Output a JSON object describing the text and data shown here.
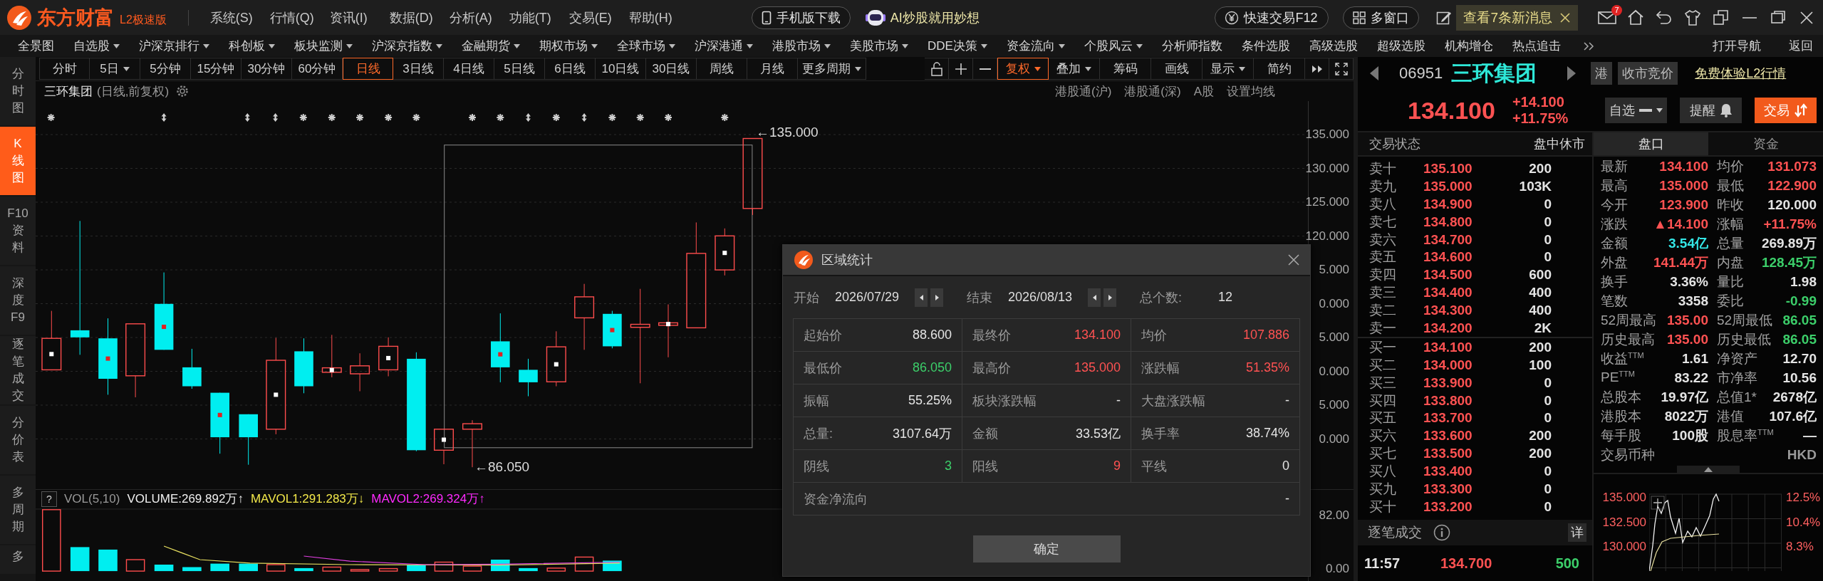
{
  "app": {
    "brand": "东方财富",
    "edition": "L2极速版",
    "menus": [
      "系统(S)",
      "行情(Q)",
      "资讯(I)",
      "数据(D)",
      "分析(A)",
      "功能(T)",
      "交易(E)",
      "帮助(H)"
    ],
    "mobile_button": "手机版下载",
    "ai_link": "AI炒股就用妙想",
    "quick_trade": "快速交易F12",
    "multi_window": "多窗口",
    "news": "查看7条新消息",
    "mail_badge": "7"
  },
  "nav": [
    {
      "label": "全景图",
      "dropdown": false
    },
    {
      "label": "自选股",
      "dropdown": true
    },
    {
      "label": "沪深京排行",
      "dropdown": true
    },
    {
      "label": "科创板",
      "dropdown": true
    },
    {
      "label": "板块监测",
      "dropdown": true
    },
    {
      "label": "沪深京指数",
      "dropdown": true
    },
    {
      "label": "金融期货",
      "dropdown": true
    },
    {
      "label": "期权市场",
      "dropdown": true
    },
    {
      "label": "全球市场",
      "dropdown": true
    },
    {
      "label": "沪深港通",
      "dropdown": true
    },
    {
      "label": "港股市场",
      "dropdown": true
    },
    {
      "label": "美股市场",
      "dropdown": true
    },
    {
      "label": "DDE决策",
      "dropdown": true
    },
    {
      "label": "资金流向",
      "dropdown": true
    },
    {
      "label": "个股风云",
      "dropdown": true
    },
    {
      "label": "分析师指数",
      "dropdown": false
    },
    {
      "label": "条件选股",
      "dropdown": false
    },
    {
      "label": "高级选股",
      "dropdown": false
    },
    {
      "label": "超级选股",
      "dropdown": false
    },
    {
      "label": "机构增仓",
      "dropdown": false
    },
    {
      "label": "热点追击",
      "dropdown": false
    }
  ],
  "nav_right": [
    "打开导航",
    "返回"
  ],
  "side_tabs": [
    {
      "label": "分时图",
      "selected": false
    },
    {
      "label": "K线图",
      "selected": true
    },
    {
      "label": "F10资料",
      "selected": false
    },
    {
      "label": "深度F9",
      "selected": false
    },
    {
      "label": "逐笔成交",
      "selected": false
    },
    {
      "label": "分价表",
      "selected": false
    },
    {
      "label": "多周期",
      "selected": false
    },
    {
      "label": "多",
      "selected": false
    }
  ],
  "periods": [
    {
      "label": "分时",
      "dropdown": false,
      "selected": false
    },
    {
      "label": "5日",
      "dropdown": true,
      "selected": false
    },
    {
      "label": "5分钟",
      "dropdown": false,
      "selected": false
    },
    {
      "label": "15分钟",
      "dropdown": false,
      "selected": false
    },
    {
      "label": "30分钟",
      "dropdown": false,
      "selected": false
    },
    {
      "label": "60分钟",
      "dropdown": false,
      "selected": false
    },
    {
      "label": "日线",
      "dropdown": false,
      "selected": true
    },
    {
      "label": "3日线",
      "dropdown": false,
      "selected": false
    },
    {
      "label": "4日线",
      "dropdown": false,
      "selected": false
    },
    {
      "label": "5日线",
      "dropdown": false,
      "selected": false
    },
    {
      "label": "6日线",
      "dropdown": false,
      "selected": false
    },
    {
      "label": "10日线",
      "dropdown": false,
      "selected": false
    },
    {
      "label": "30日线",
      "dropdown": false,
      "selected": false
    },
    {
      "label": "周线",
      "dropdown": false,
      "selected": false
    },
    {
      "label": "月线",
      "dropdown": false,
      "selected": false
    },
    {
      "label": "更多周期",
      "dropdown": true,
      "selected": false
    }
  ],
  "tools": [
    {
      "label": "复权",
      "dropdown": true,
      "selected": true
    },
    {
      "label": "叠加",
      "dropdown": true,
      "selected": false
    },
    {
      "label": "筹码",
      "dropdown": false,
      "selected": false
    },
    {
      "label": "画线",
      "dropdown": false,
      "selected": false
    },
    {
      "label": "显示",
      "dropdown": true,
      "selected": false
    },
    {
      "label": "简约",
      "dropdown": false,
      "selected": false
    }
  ],
  "chart": {
    "title": "三环集团",
    "subtitle": "(日线,前复权)",
    "links": [
      "港股通(沪)",
      "港股通(深)",
      "A股",
      "设置均线"
    ],
    "price_ticks": [
      "135.000",
      "130.000",
      "125.000",
      "120.000",
      "5.000",
      "0.000",
      "5.000",
      "0.000",
      "5.000",
      "0.000"
    ],
    "high_label": "←135.000",
    "low_label": "←86.050"
  },
  "volume": {
    "help": "?",
    "name": "VOL(5,10)",
    "volume": "VOLUME:269.892万↑",
    "mavol1": "MAVOL1:291.283万↓",
    "mavol2": "MAVOL2:269.324万↑",
    "ticks": [
      "82.00",
      "0.00"
    ]
  },
  "quote": {
    "code": "06951",
    "name": "三环集团",
    "market": "港",
    "session": "收市竞价",
    "l2_link": "免费体验L2行情",
    "price": "134.100",
    "change": "+14.100",
    "change_pct": "+11.75%",
    "watch": "自选",
    "alert": "提醒",
    "trade": "交易",
    "status_label": "交易状态",
    "status": "盘中休市",
    "asks": [
      {
        "label": "卖十",
        "price": "135.100",
        "qty": "200"
      },
      {
        "label": "卖九",
        "price": "135.000",
        "qty": "103K"
      },
      {
        "label": "卖八",
        "price": "134.900",
        "qty": "0"
      },
      {
        "label": "卖七",
        "price": "134.800",
        "qty": "0"
      },
      {
        "label": "卖六",
        "price": "134.700",
        "qty": "0"
      },
      {
        "label": "卖五",
        "price": "134.600",
        "qty": "0"
      },
      {
        "label": "卖四",
        "price": "134.500",
        "qty": "600"
      },
      {
        "label": "卖三",
        "price": "134.400",
        "qty": "400"
      },
      {
        "label": "卖二",
        "price": "134.300",
        "qty": "400"
      },
      {
        "label": "卖一",
        "price": "134.200",
        "qty": "2K"
      }
    ],
    "bids": [
      {
        "label": "买一",
        "price": "134.100",
        "qty": "200"
      },
      {
        "label": "买二",
        "price": "134.000",
        "qty": "100"
      },
      {
        "label": "买三",
        "price": "133.900",
        "qty": "0"
      },
      {
        "label": "买四",
        "price": "133.800",
        "qty": "0"
      },
      {
        "label": "买五",
        "price": "133.700",
        "qty": "0"
      },
      {
        "label": "买六",
        "price": "133.600",
        "qty": "200"
      },
      {
        "label": "买七",
        "price": "133.500",
        "qty": "200"
      },
      {
        "label": "买八",
        "price": "133.400",
        "qty": "0"
      },
      {
        "label": "买九",
        "price": "133.300",
        "qty": "0"
      },
      {
        "label": "买十",
        "price": "133.200",
        "qty": "0"
      }
    ],
    "tabs": [
      {
        "label": "盘口",
        "selected": true
      },
      {
        "label": "资金",
        "selected": false
      }
    ],
    "stats": [
      {
        "cells": [
          {
            "label": "最新",
            "value": "134.100",
            "color": "#ff5252"
          },
          {
            "label": "均价",
            "value": "131.073",
            "color": "#ff5252"
          }
        ]
      },
      {
        "cells": [
          {
            "label": "最高",
            "value": "135.000",
            "color": "#ff5252"
          },
          {
            "label": "最低",
            "value": "122.900",
            "color": "#ff5252"
          }
        ]
      },
      {
        "cells": [
          {
            "label": "今开",
            "value": "123.900",
            "color": "#ff5252"
          },
          {
            "label": "昨收",
            "value": "120.000",
            "color": "#e4e4e4"
          }
        ]
      },
      {
        "cells": [
          {
            "label": "涨跌",
            "value": "▲14.100",
            "color": "#ff5252"
          },
          {
            "label": "涨幅",
            "value": "+11.75%",
            "color": "#ff5252"
          }
        ]
      },
      {
        "cells": [
          {
            "label": "金额",
            "value": "3.54亿",
            "color": "#34e6e6"
          },
          {
            "label": "总量",
            "value": "269.89万",
            "color": "#e4e4e4"
          }
        ]
      },
      {
        "cells": [
          {
            "label": "外盘",
            "value": "141.44万",
            "color": "#ff5252"
          },
          {
            "label": "内盘",
            "value": "128.45万",
            "color": "#3ccf6a"
          }
        ]
      },
      {
        "cells": [
          {
            "label": "换手",
            "value": "3.36%",
            "color": "#e4e4e4"
          },
          {
            "label": "量比",
            "value": "1.98",
            "color": "#e4e4e4"
          }
        ]
      },
      {
        "cells": [
          {
            "label": "笔数",
            "value": "3358",
            "color": "#e4e4e4"
          },
          {
            "label": "委比",
            "value": "-0.99",
            "color": "#3ccf6a"
          }
        ]
      },
      {
        "cells": [
          {
            "label": "52周最高",
            "value": "135.00",
            "color": "#ff5252"
          },
          {
            "label": "52周最低",
            "value": "86.05",
            "color": "#3ccf6a"
          }
        ]
      },
      {
        "cells": [
          {
            "label": "历史最高",
            "value": "135.00",
            "color": "#ff5252"
          },
          {
            "label": "历史最低",
            "value": "86.05",
            "color": "#3ccf6a"
          }
        ]
      },
      {
        "cells": [
          {
            "label": "收益$^{TTM}$",
            "value": "1.61",
            "color": "#e4e4e4"
          },
          {
            "label": "净资产",
            "value": "12.70",
            "color": "#e4e4e4"
          }
        ]
      },
      {
        "cells": [
          {
            "label": "PE$^{TTM}$",
            "value": "83.22",
            "color": "#e4e4e4"
          },
          {
            "label": "市净率",
            "value": "10.56",
            "color": "#e4e4e4"
          }
        ]
      },
      {
        "cells": [
          {
            "label": "总股本",
            "value": "19.97亿",
            "color": "#e4e4e4"
          },
          {
            "label": "总值1*",
            "value": "2678亿",
            "color": "#e4e4e4"
          }
        ]
      },
      {
        "cells": [
          {
            "label": "港股本",
            "value": "8022万",
            "color": "#e4e4e4"
          },
          {
            "label": "港值",
            "value": "107.6亿",
            "color": "#e4e4e4"
          }
        ]
      },
      {
        "cells": [
          {
            "label": "每手股",
            "value": "100股",
            "color": "#e4e4e4"
          },
          {
            "label": "股息率$^{TTM}$",
            "value": "—",
            "color": "#e4e4e4"
          }
        ]
      },
      {
        "cells": [
          {
            "label": "交易币种",
            "value": "HKD",
            "color": "#9a9a9a"
          }
        ]
      }
    ],
    "trades_title": "逐笔成交",
    "detail": "详",
    "trades": [
      {
        "time": "11:57",
        "price": "134.700",
        "qty": "500",
        "color": "#3ccf6a"
      }
    ],
    "mini_chart": {
      "left_ticks": [
        "135.000",
        "132.500",
        "130.000"
      ],
      "right_ticks": [
        "12.5%",
        "10.4%",
        "8.3%"
      ]
    }
  },
  "dialog": {
    "title": "区域统计",
    "start_label": "开始",
    "start": "2026/07/29",
    "end_label": "结束",
    "end": "2026/08/13",
    "count_label": "总个数:",
    "count": "12",
    "cells": [
      {
        "label": "起始价",
        "value": "88.600",
        "color": "#e4e4e4"
      },
      {
        "label": "最终价",
        "value": "134.100",
        "color": "#ff5252"
      },
      {
        "label": "均价",
        "value": "107.886",
        "color": "#ff5252"
      },
      {
        "label": "最低价",
        "value": "86.050",
        "color": "#3ccf6a"
      },
      {
        "label": "最高价",
        "value": "135.000",
        "color": "#ff5252"
      },
      {
        "label": "涨跌幅",
        "value": "51.35%",
        "color": "#ff5252"
      },
      {
        "label": "振幅",
        "value": "55.25%",
        "color": "#e4e4e4"
      },
      {
        "label": "板块涨跌幅",
        "value": "-",
        "color": "#e4e4e4"
      },
      {
        "label": "大盘涨跌幅",
        "value": "-",
        "color": "#e4e4e4"
      },
      {
        "label": "总量:",
        "value": "3107.64万",
        "color": "#e4e4e4"
      },
      {
        "label": "金额",
        "value": "33.53亿",
        "color": "#e4e4e4"
      },
      {
        "label": "换手率",
        "value": "38.74%",
        "color": "#e4e4e4"
      },
      {
        "label": "阴线",
        "value": "3",
        "color": "#3ccf6a"
      },
      {
        "label": "阳线",
        "value": "9",
        "color": "#ff5252"
      },
      {
        "label": "平线",
        "value": "0",
        "color": "#e4e4e4"
      }
    ],
    "net_flow": {
      "label": "资金净流向",
      "value": "-"
    },
    "ok": "确定"
  }
}
